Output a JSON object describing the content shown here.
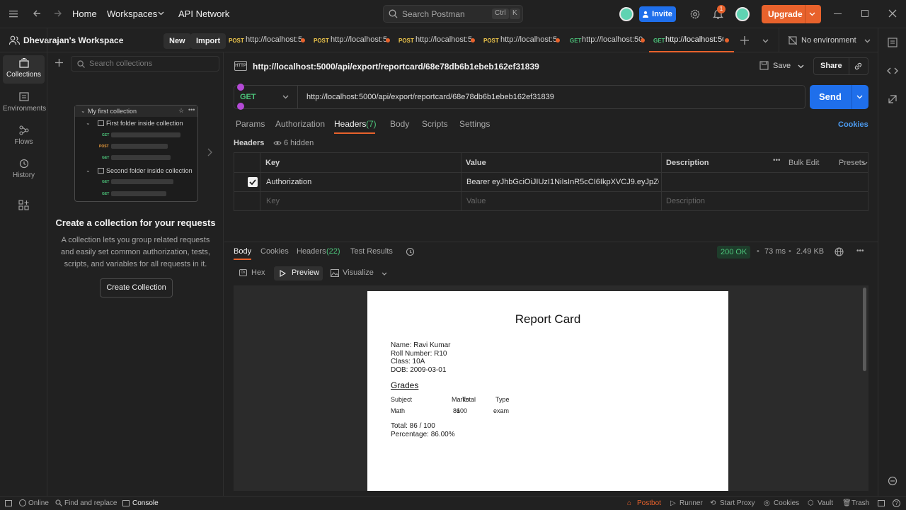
{
  "topbar": {
    "home": "Home",
    "workspaces": "Workspaces",
    "api_network": "API Network",
    "search_placeholder": "Search Postman",
    "kbd_ctrl": "Ctrl",
    "kbd_k": "K",
    "invite": "Invite",
    "notification_count": "1",
    "upgrade": "Upgrade"
  },
  "sidebar": {
    "workspace_name": "Dhevarajan's Workspace",
    "new_btn": "New",
    "import_btn": "Import",
    "search_placeholder": "Search collections",
    "rail": [
      {
        "label": "Collections",
        "icon": "collections-icon"
      },
      {
        "label": "Environments",
        "icon": "environments-icon"
      },
      {
        "label": "Flows",
        "icon": "flows-icon"
      },
      {
        "label": "History",
        "icon": "history-icon"
      }
    ],
    "illustration": {
      "collection": "My first collection",
      "folder1": "First folder inside collection",
      "folder2": "Second folder inside collection",
      "m_get": "GET",
      "m_post": "POST"
    },
    "empty_title": "Create a collection for your requests",
    "empty_desc": "A collection lets you group related requests and easily set common authorization, tests, scripts, and variables for all requests in it.",
    "create_btn": "Create Collection"
  },
  "tabs": [
    {
      "method": "POST",
      "url": "http://localhost:5",
      "color": "#f2c94c"
    },
    {
      "method": "POST",
      "url": "http://localhost:5",
      "color": "#f2c94c"
    },
    {
      "method": "POST",
      "url": "http://localhost:5",
      "color": "#f2c94c"
    },
    {
      "method": "POST",
      "url": "http://localhost:5",
      "color": "#f2c94c"
    },
    {
      "method": "GET",
      "url": "http://localhost:50",
      "color": "#4cc37a"
    },
    {
      "method": "GET",
      "url": "http://localhost:50",
      "color": "#4cc37a",
      "active": true
    }
  ],
  "env": {
    "label": "No environment"
  },
  "request": {
    "title": "http://localhost:5000/api/export/reportcard/68e78db6b1ebeb162ef31839",
    "save": "Save",
    "share": "Share",
    "method": "GET",
    "url": "http://localhost:5000/api/export/reportcard/68e78db6b1ebeb162ef31839",
    "send": "Send",
    "tabs": [
      "Params",
      "Authorization",
      "Headers",
      "Body",
      "Scripts",
      "Settings"
    ],
    "headers_count": "(7)",
    "cookies": "Cookies",
    "headers_label": "Headers",
    "hidden": "6 hidden",
    "table": {
      "col_key": "Key",
      "col_value": "Value",
      "col_desc": "Description",
      "bulk_edit": "Bulk Edit",
      "presets": "Presets",
      "row_key": "Authorization",
      "row_value": "Bearer eyJhbGciOiJIUzI1NiIsInR5cCI6IkpXVCJ9.eyJpZCI...",
      "ph_key": "Key",
      "ph_value": "Value",
      "ph_desc": "Description"
    }
  },
  "response": {
    "tabs": [
      "Body",
      "Cookies",
      "Headers",
      "Test Results"
    ],
    "headers_count": "(22)",
    "status": "200 OK",
    "time": "73 ms",
    "size": "2.49 KB",
    "modes": [
      "Hex",
      "Preview",
      "Visualize"
    ],
    "report": {
      "title": "Report Card",
      "name": "Name: Ravi Kumar",
      "roll": "Roll Number: R10",
      "class": "Class: 10A",
      "dob": "DOB: 2009-03-01",
      "grades": "Grades",
      "col_subject": "Subject",
      "col_marks": "Marks",
      "col_total": "Total",
      "col_type": "Type",
      "subject": "Math",
      "marks": "86",
      "total": "100",
      "type": "exam",
      "total_line": "Total: 86 / 100",
      "percentage": "Percentage: 86.00%"
    }
  },
  "bottombar": {
    "online": "Online",
    "find": "Find and replace",
    "console": "Console",
    "postbot": "Postbot",
    "runner": "Runner",
    "proxy": "Start Proxy",
    "cookies": "Cookies",
    "vault": "Vault",
    "trash": "Trash"
  }
}
